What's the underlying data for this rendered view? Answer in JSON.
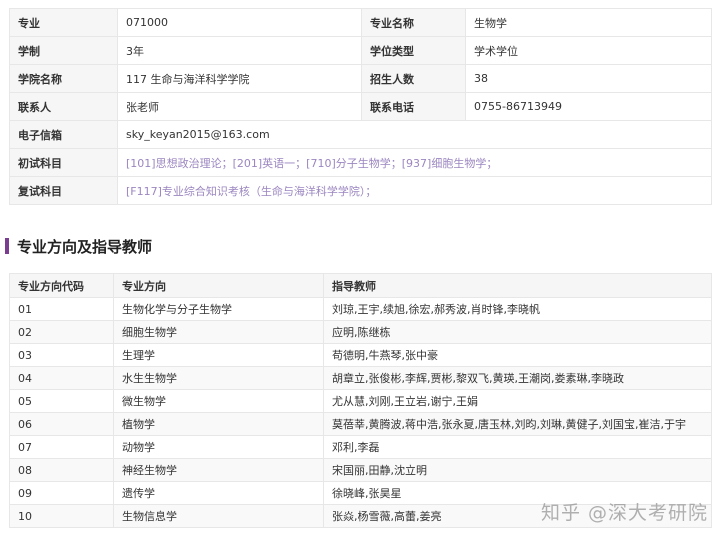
{
  "info": {
    "rows": [
      {
        "l1": "专业",
        "v1": "071000",
        "l2": "专业名称",
        "v2": "生物学"
      },
      {
        "l1": "学制",
        "v1": "3年",
        "l2": "学位类型",
        "v2": "学术学位"
      },
      {
        "l1": "学院名称",
        "v1": "117 生命与海洋科学学院",
        "l2": "招生人数",
        "v2": "38"
      },
      {
        "l1": "联系人",
        "v1": "张老师",
        "l2": "联系电话",
        "v2": "0755-86713949"
      }
    ],
    "email_label": "电子信箱",
    "email": "sky_keyan2015@163.com",
    "exam_label": "初试科目",
    "exam_subjects": "[101]思想政治理论；[201]英语一；[710]分子生物学；[937]细胞生物学；",
    "retest_label": "复试科目",
    "retest_subjects": "[F117]专业综合知识考核（生命与海洋科学学院）；"
  },
  "section_title": "专业方向及指导教师",
  "directions": {
    "headers": [
      "专业方向代码",
      "专业方向",
      "指导教师"
    ],
    "rows": [
      [
        "01",
        "生物化学与分子生物学",
        "刘琼,王宇,续旭,徐宏,郝秀波,肖时锋,李晓帆"
      ],
      [
        "02",
        "细胞生物学",
        "应明,陈继栋"
      ],
      [
        "03",
        "生理学",
        "苟德明,牛燕琴,张中豪"
      ],
      [
        "04",
        "水生生物学",
        "胡章立,张俊彬,李辉,贾彬,黎双飞,黄瑛,王潮岗,娄素琳,李晓政"
      ],
      [
        "05",
        "微生物学",
        "尤从慧,刘刚,王立岩,谢宁,王娟"
      ],
      [
        "06",
        "植物学",
        "莫蓓莘,黄腾波,蒋中浩,张永夏,唐玉林,刘昀,刘琳,黄健子,刘国宝,崔洁,于宇"
      ],
      [
        "07",
        "动物学",
        "邓利,李磊"
      ],
      [
        "08",
        "神经生物学",
        "宋国丽,田静,沈立明"
      ],
      [
        "09",
        "遗传学",
        "徐晓峰,张昊星"
      ],
      [
        "10",
        "生物信息学",
        "张焱,杨雪薇,高蕾,姜亮"
      ]
    ]
  },
  "watermark": "知乎 @深大考研院"
}
